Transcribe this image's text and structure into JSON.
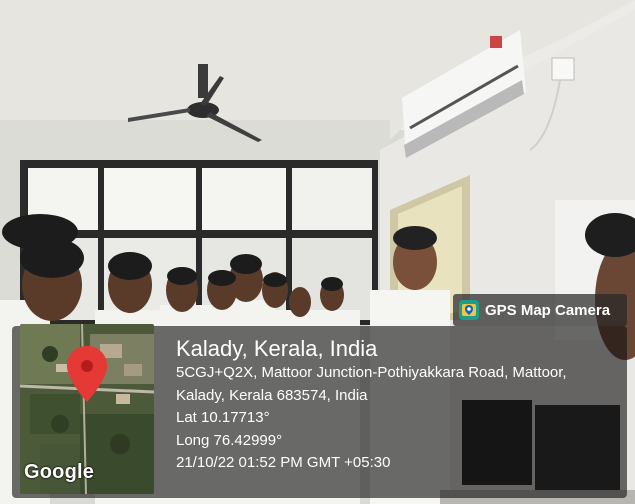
{
  "overlay": {
    "badge_label": "GPS Map Camera",
    "city": "Kalady, Kerala, India",
    "address_line1": "5CGJ+Q2X, Mattoor Junction-Pothiyakkara Road, Mattoor,",
    "address_line2": "Kalady, Kerala 683574, India",
    "lat": "Lat 10.17713°",
    "long": "Long 76.42999°",
    "datetime": "21/10/22 01:52 PM GMT +05:30",
    "map_brand": "Google"
  },
  "icons": {
    "badge": "gps-map-camera-app-icon",
    "pin": "map-pin-icon"
  },
  "colors": {
    "panel": "#141414",
    "pin": "#e53935",
    "badge_icon": "#1e9e8a"
  }
}
